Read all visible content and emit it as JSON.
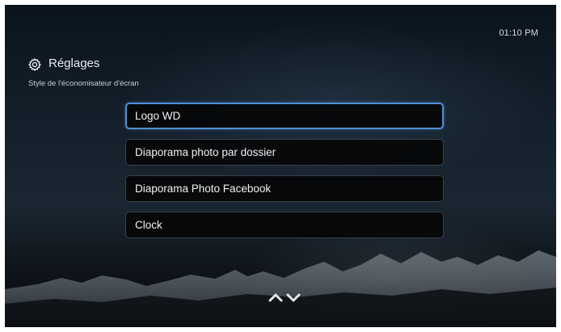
{
  "clock": "01:10 PM",
  "header": {
    "title": "Réglages",
    "subtitle": "Style de l'économisateur d'écran",
    "icon": "gear-icon"
  },
  "menu": {
    "selected_index": 0,
    "items": [
      {
        "label": "Logo WD"
      },
      {
        "label": "Diaporama photo par dossier"
      },
      {
        "label": "Diaporama Photo Facebook"
      },
      {
        "label": "Clock"
      }
    ]
  },
  "navigation": {
    "icons": [
      "chevron-up-icon",
      "chevron-down-icon"
    ]
  },
  "colors": {
    "selection_border": "#4f8fd6",
    "item_background": "#050608",
    "text": "#eef0f2"
  }
}
